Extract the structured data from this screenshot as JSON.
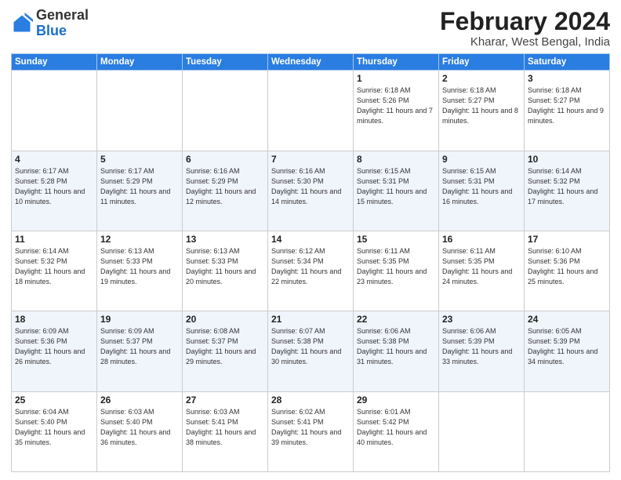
{
  "header": {
    "logo_general": "General",
    "logo_blue": "Blue",
    "month_title": "February 2024",
    "subtitle": "Kharar, West Bengal, India"
  },
  "weekdays": [
    "Sunday",
    "Monday",
    "Tuesday",
    "Wednesday",
    "Thursday",
    "Friday",
    "Saturday"
  ],
  "weeks": [
    [
      {
        "day": "",
        "info": ""
      },
      {
        "day": "",
        "info": ""
      },
      {
        "day": "",
        "info": ""
      },
      {
        "day": "",
        "info": ""
      },
      {
        "day": "1",
        "info": "Sunrise: 6:18 AM\nSunset: 5:26 PM\nDaylight: 11 hours\nand 7 minutes."
      },
      {
        "day": "2",
        "info": "Sunrise: 6:18 AM\nSunset: 5:27 PM\nDaylight: 11 hours\nand 8 minutes."
      },
      {
        "day": "3",
        "info": "Sunrise: 6:18 AM\nSunset: 5:27 PM\nDaylight: 11 hours\nand 9 minutes."
      }
    ],
    [
      {
        "day": "4",
        "info": "Sunrise: 6:17 AM\nSunset: 5:28 PM\nDaylight: 11 hours\nand 10 minutes."
      },
      {
        "day": "5",
        "info": "Sunrise: 6:17 AM\nSunset: 5:29 PM\nDaylight: 11 hours\nand 11 minutes."
      },
      {
        "day": "6",
        "info": "Sunrise: 6:16 AM\nSunset: 5:29 PM\nDaylight: 11 hours\nand 12 minutes."
      },
      {
        "day": "7",
        "info": "Sunrise: 6:16 AM\nSunset: 5:30 PM\nDaylight: 11 hours\nand 14 minutes."
      },
      {
        "day": "8",
        "info": "Sunrise: 6:15 AM\nSunset: 5:31 PM\nDaylight: 11 hours\nand 15 minutes."
      },
      {
        "day": "9",
        "info": "Sunrise: 6:15 AM\nSunset: 5:31 PM\nDaylight: 11 hours\nand 16 minutes."
      },
      {
        "day": "10",
        "info": "Sunrise: 6:14 AM\nSunset: 5:32 PM\nDaylight: 11 hours\nand 17 minutes."
      }
    ],
    [
      {
        "day": "11",
        "info": "Sunrise: 6:14 AM\nSunset: 5:32 PM\nDaylight: 11 hours\nand 18 minutes."
      },
      {
        "day": "12",
        "info": "Sunrise: 6:13 AM\nSunset: 5:33 PM\nDaylight: 11 hours\nand 19 minutes."
      },
      {
        "day": "13",
        "info": "Sunrise: 6:13 AM\nSunset: 5:33 PM\nDaylight: 11 hours\nand 20 minutes."
      },
      {
        "day": "14",
        "info": "Sunrise: 6:12 AM\nSunset: 5:34 PM\nDaylight: 11 hours\nand 22 minutes."
      },
      {
        "day": "15",
        "info": "Sunrise: 6:11 AM\nSunset: 5:35 PM\nDaylight: 11 hours\nand 23 minutes."
      },
      {
        "day": "16",
        "info": "Sunrise: 6:11 AM\nSunset: 5:35 PM\nDaylight: 11 hours\nand 24 minutes."
      },
      {
        "day": "17",
        "info": "Sunrise: 6:10 AM\nSunset: 5:36 PM\nDaylight: 11 hours\nand 25 minutes."
      }
    ],
    [
      {
        "day": "18",
        "info": "Sunrise: 6:09 AM\nSunset: 5:36 PM\nDaylight: 11 hours\nand 26 minutes."
      },
      {
        "day": "19",
        "info": "Sunrise: 6:09 AM\nSunset: 5:37 PM\nDaylight: 11 hours\nand 28 minutes."
      },
      {
        "day": "20",
        "info": "Sunrise: 6:08 AM\nSunset: 5:37 PM\nDaylight: 11 hours\nand 29 minutes."
      },
      {
        "day": "21",
        "info": "Sunrise: 6:07 AM\nSunset: 5:38 PM\nDaylight: 11 hours\nand 30 minutes."
      },
      {
        "day": "22",
        "info": "Sunrise: 6:06 AM\nSunset: 5:38 PM\nDaylight: 11 hours\nand 31 minutes."
      },
      {
        "day": "23",
        "info": "Sunrise: 6:06 AM\nSunset: 5:39 PM\nDaylight: 11 hours\nand 33 minutes."
      },
      {
        "day": "24",
        "info": "Sunrise: 6:05 AM\nSunset: 5:39 PM\nDaylight: 11 hours\nand 34 minutes."
      }
    ],
    [
      {
        "day": "25",
        "info": "Sunrise: 6:04 AM\nSunset: 5:40 PM\nDaylight: 11 hours\nand 35 minutes."
      },
      {
        "day": "26",
        "info": "Sunrise: 6:03 AM\nSunset: 5:40 PM\nDaylight: 11 hours\nand 36 minutes."
      },
      {
        "day": "27",
        "info": "Sunrise: 6:03 AM\nSunset: 5:41 PM\nDaylight: 11 hours\nand 38 minutes."
      },
      {
        "day": "28",
        "info": "Sunrise: 6:02 AM\nSunset: 5:41 PM\nDaylight: 11 hours\nand 39 minutes."
      },
      {
        "day": "29",
        "info": "Sunrise: 6:01 AM\nSunset: 5:42 PM\nDaylight: 11 hours\nand 40 minutes."
      },
      {
        "day": "",
        "info": ""
      },
      {
        "day": "",
        "info": ""
      }
    ]
  ]
}
